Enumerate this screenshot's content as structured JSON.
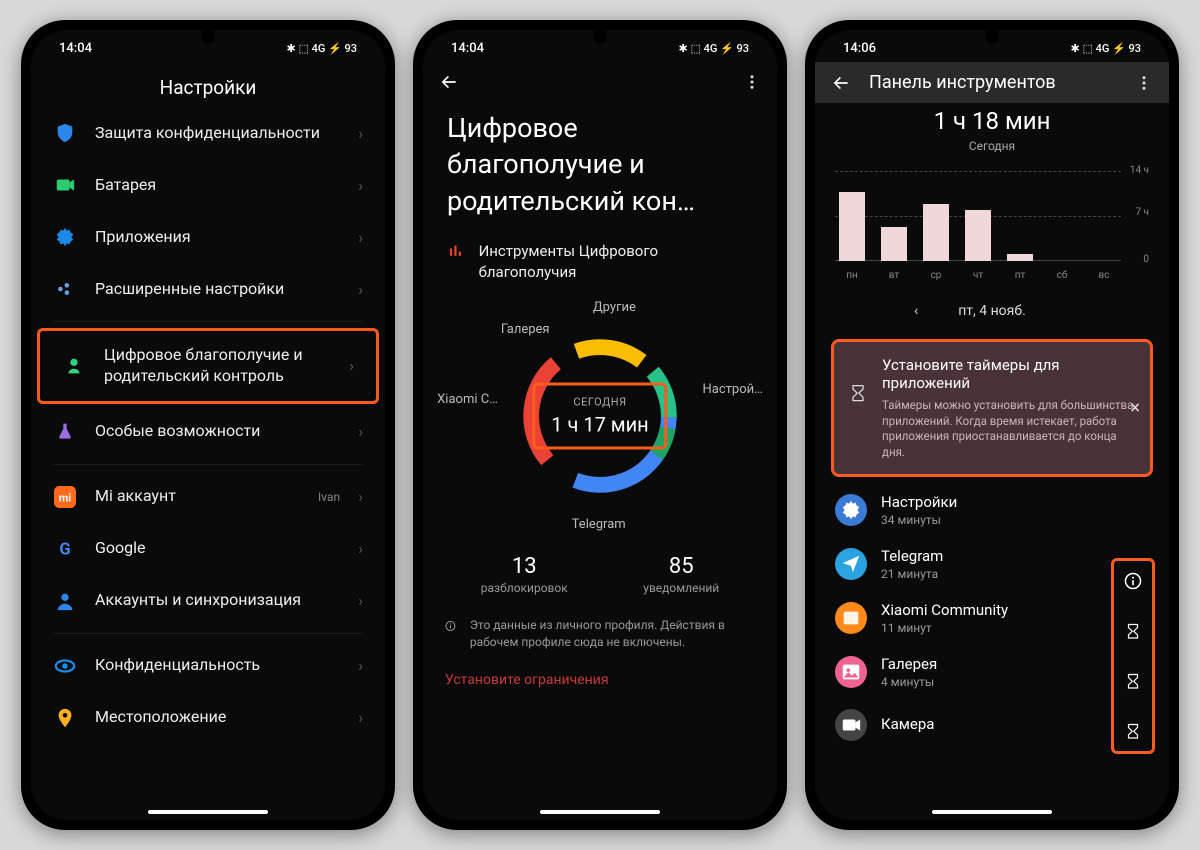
{
  "phone1": {
    "time": "14:04",
    "status_icons": "✱ ⬚ 4G ⚡ 93",
    "header": "Настройки",
    "items": [
      {
        "icon": "shield",
        "label": "Защита конфиденциальности",
        "color": "#2b87e9"
      },
      {
        "icon": "camera",
        "label": "Батарея",
        "color": "#2bcc6e"
      },
      {
        "icon": "gear",
        "label": "Приложения",
        "color": "#1a8ae6"
      },
      {
        "icon": "dots",
        "label": "Расширенные настройки",
        "color": "#6aa2e0"
      }
    ],
    "highlighted": {
      "icon": "heart-person",
      "label": "Цифровое благополучие и родительский контроль",
      "color": "#33d17a"
    },
    "item_after": {
      "icon": "flask",
      "label": "Особые возможности",
      "color": "#9b6be0"
    },
    "accounts": [
      {
        "icon": "mi",
        "label": "Mi аккаунт",
        "value": "Ivan",
        "color": "#ff6b1a"
      },
      {
        "icon": "g",
        "label": "Google",
        "color": "#4285f4"
      },
      {
        "icon": "person",
        "label": "Аккаунты и синхронизация",
        "color": "#2b87e9"
      }
    ],
    "bottom": [
      {
        "icon": "eye",
        "label": "Конфиденциальность",
        "color": "#1a8ae6"
      },
      {
        "icon": "pin",
        "label": "Местоположение",
        "color": "#ffb020"
      }
    ]
  },
  "phone2": {
    "time": "14:04",
    "status_icons": "✱ ⬚ 4G ⚡ 93",
    "title": "Цифровое благополучие и родительский кон…",
    "section_label": "Инструменты Цифрового благополучия",
    "donut": {
      "today_label": "СЕГОДНЯ",
      "total": "1 ч 17 мин",
      "segments": [
        {
          "label": "Другие",
          "color": "#1fa463"
        },
        {
          "label": "Галерея",
          "color": "#25c389"
        },
        {
          "label": "Xiaomi C…",
          "color": "#fbbc04"
        },
        {
          "label": "Telegram",
          "color": "#ea4335"
        },
        {
          "label": "Настрой…",
          "color": "#4285f4"
        }
      ]
    },
    "stats": [
      {
        "num": "13",
        "label": "разблокировок"
      },
      {
        "num": "85",
        "label": "уведомлений"
      }
    ],
    "info_text": "Это данные из личного профиля. Действия в рабочем профиле сюда не включены.",
    "link": "Установите ограничения"
  },
  "phone3": {
    "time": "14:06",
    "status_icons": "✱ ⬚ 4G ⚡ 93",
    "header": "Панель инструментов",
    "total_time": "1 ч 18 мин",
    "total_sub": "Сегодня",
    "date": "пт, 4 нояб.",
    "tip": {
      "title": "Установите таймеры для приложений",
      "body": "Таймеры можно установить для большинства приложений. Когда время истекает, работа приложения приостанавливается до конца дня."
    },
    "apps": [
      {
        "name": "Настройки",
        "time": "34 минуты",
        "bg": "#3b7bd6",
        "icon": "gear"
      },
      {
        "name": "Telegram",
        "time": "21 минута",
        "bg": "#2aa3e0",
        "icon": "plane"
      },
      {
        "name": "Xiaomi Community",
        "time": "11 минут",
        "bg": "#ff8a1a",
        "icon": "xc"
      },
      {
        "name": "Галерея",
        "time": "4 минуты",
        "bg": "#f06292",
        "icon": "gallery"
      },
      {
        "name": "Камера",
        "time": "",
        "bg": "#444",
        "icon": "camera"
      }
    ]
  },
  "chart_data": {
    "type": "bar",
    "categories": [
      "пн",
      "вт",
      "ср",
      "чт",
      "пт",
      "сб",
      "вс"
    ],
    "values": [
      12,
      6,
      10,
      9,
      1.3,
      0,
      0
    ],
    "ylim": [
      0,
      14
    ],
    "ylabels": [
      "14 ч",
      "7 ч",
      "0"
    ],
    "title": "",
    "xlabel": "",
    "ylabel": ""
  }
}
